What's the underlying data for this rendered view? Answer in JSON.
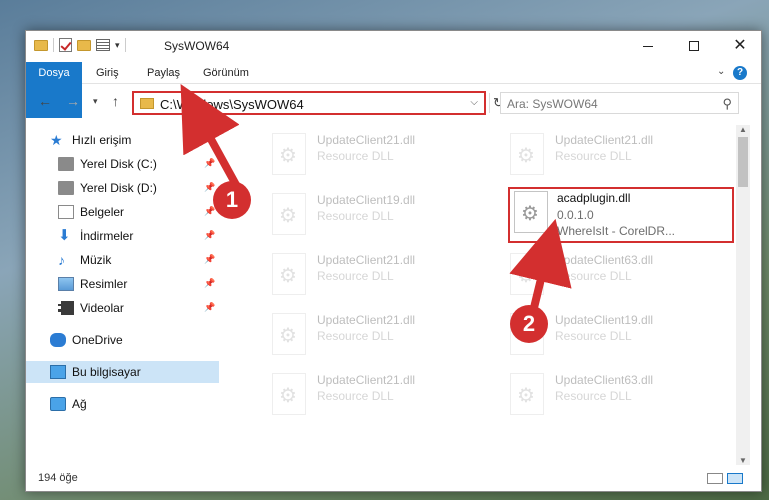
{
  "window": {
    "title": "SysWOW64"
  },
  "ribbon": {
    "tabs": [
      "Dosya",
      "Giriş",
      "Paylaş",
      "Görünüm"
    ],
    "help": "?"
  },
  "nav": {
    "back": "←",
    "forward": "→",
    "recent": "▾",
    "up": "↑"
  },
  "address": {
    "path": "C:\\Windows\\SysWOW64",
    "dropdown": "⌵",
    "refresh": "↻"
  },
  "search": {
    "placeholder": "Ara: SysWOW64",
    "icon": "⚲"
  },
  "sidebar": {
    "items": [
      {
        "label": "Hızlı erişim",
        "icon": "quick-access-icon"
      },
      {
        "label": "Yerel Disk (C:)",
        "icon": "drive-icon",
        "pinned": true
      },
      {
        "label": "Yerel Disk (D:)",
        "icon": "drive-icon",
        "pinned": true
      },
      {
        "label": "Belgeler",
        "icon": "documents-icon",
        "pinned": true
      },
      {
        "label": "İndirmeler",
        "icon": "downloads-icon",
        "pinned": true
      },
      {
        "label": "Müzik",
        "icon": "music-icon",
        "pinned": true
      },
      {
        "label": "Resimler",
        "icon": "pictures-icon",
        "pinned": true
      },
      {
        "label": "Videolar",
        "icon": "videos-icon",
        "pinned": true
      },
      {
        "label": "OneDrive",
        "icon": "onedrive-icon"
      },
      {
        "label": "Bu bilgisayar",
        "icon": "this-pc-icon",
        "selected": true
      },
      {
        "label": "Ağ",
        "icon": "network-icon"
      }
    ]
  },
  "files": [
    {
      "name": "UpdateClient21.dll",
      "type": "Resource DLL"
    },
    {
      "name": "UpdateClient21.dll",
      "type": "Resource DLL"
    },
    {
      "name": "UpdateClient19.dll",
      "type": "Resource DLL"
    },
    {
      "name": "acadplugin.dll",
      "version": "0.0.1.0",
      "company": "WhereIsIt - CorelDR..."
    },
    {
      "name": "UpdateClient21.dll",
      "type": "Resource DLL"
    },
    {
      "name": "UpdateClient63.dll",
      "type": "Resource DLL"
    },
    {
      "name": "UpdateClient21.dll",
      "type": "Resource DLL"
    },
    {
      "name": "UpdateClient19.dll",
      "type": "Resource DLL"
    },
    {
      "name": "UpdateClient21.dll",
      "type": "Resource DLL"
    },
    {
      "name": "UpdateClient63.dll",
      "type": "Resource DLL"
    }
  ],
  "status": {
    "count": "194 öğe"
  },
  "annotations": {
    "step1": "1",
    "step2": "2",
    "color": "#d32f2f"
  }
}
